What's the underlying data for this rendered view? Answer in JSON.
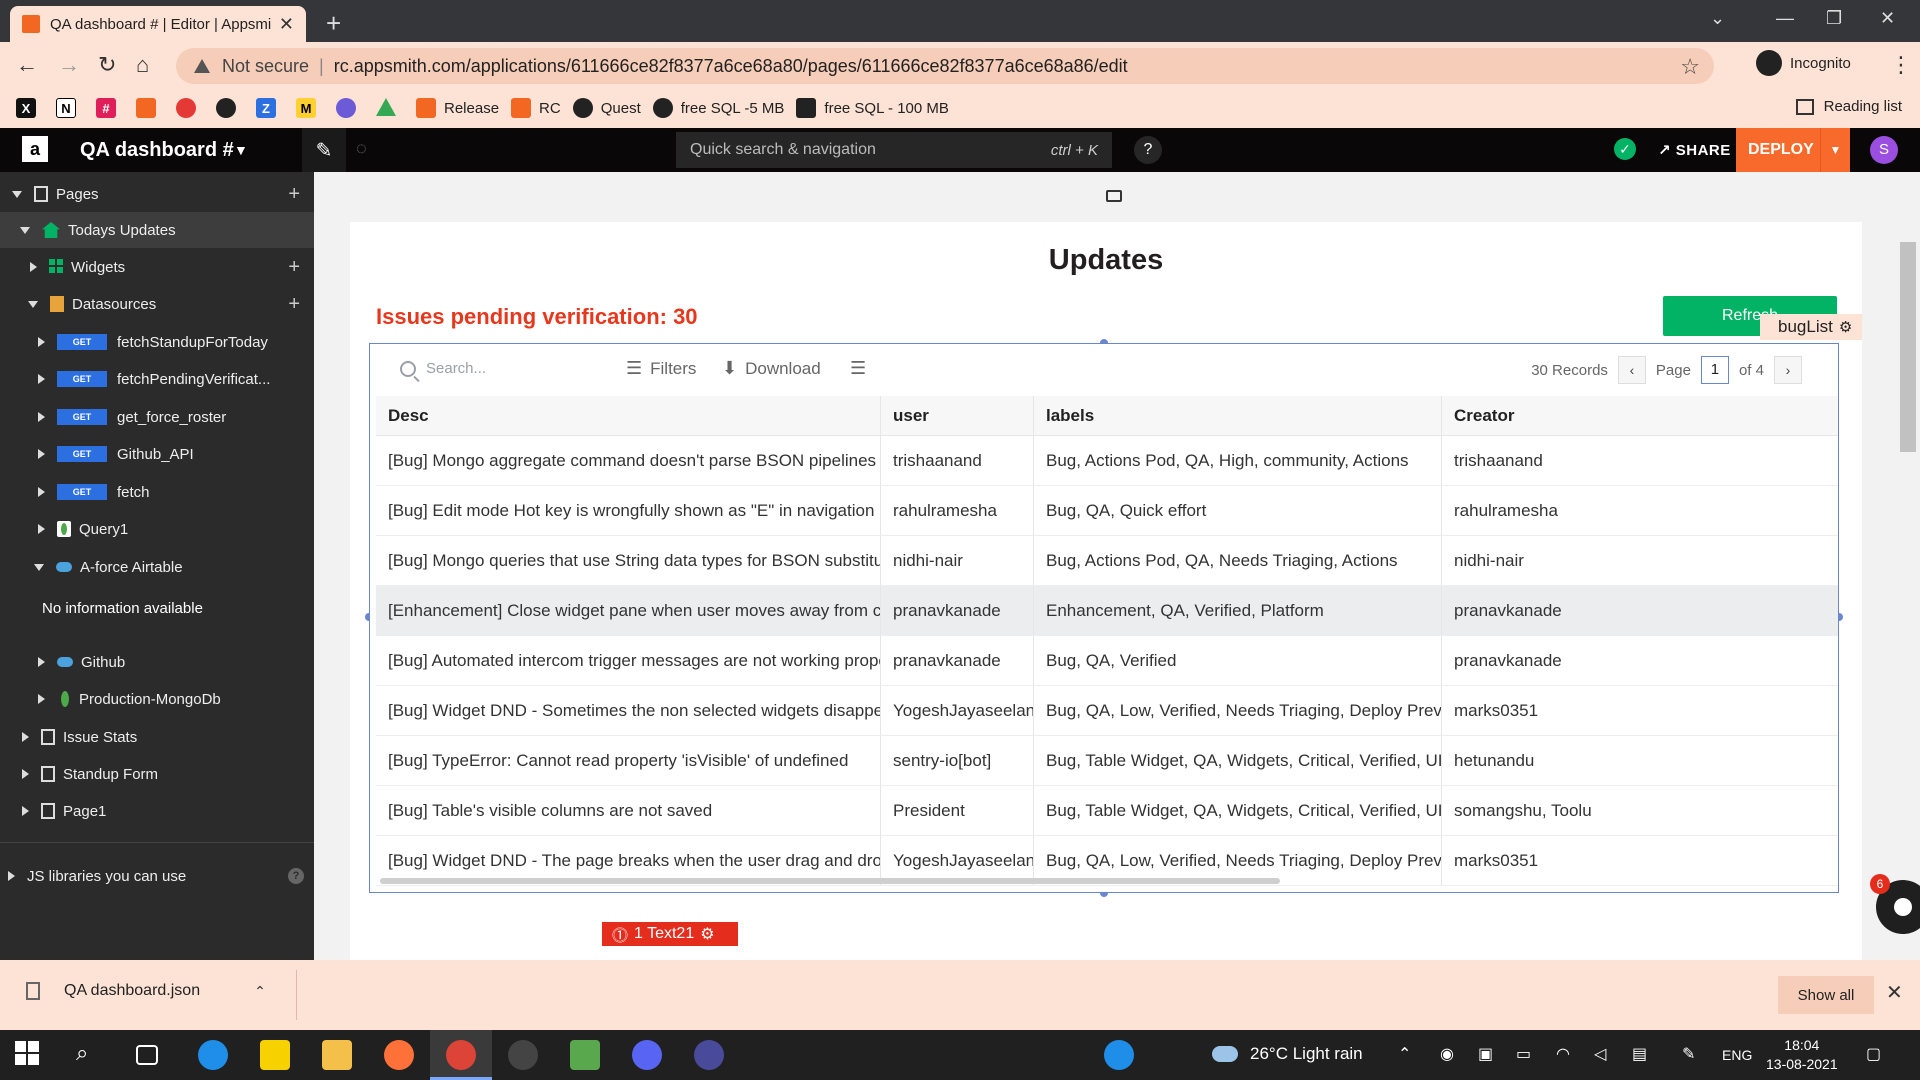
{
  "browser": {
    "tab_title": "QA dashboard # | Editor | Appsmith",
    "security_label": "Not secure",
    "url": "rc.appsmith.com/applications/611666ce82f8377a6ce68a80/pages/611666ce82f8377a6ce68a86/edit",
    "profile_label": "Incognito",
    "bookmarks": [
      "Release",
      "RC",
      "Quest",
      "free SQL -5 MB",
      "free SQL - 100 MB"
    ],
    "reading_list": "Reading list"
  },
  "app_header": {
    "logo": "a",
    "app_name": "QA dashboard #",
    "search_placeholder": "Quick search & navigation",
    "search_shortcut": "ctrl + K",
    "help": "?",
    "share": "SHARE",
    "deploy": "DEPLOY",
    "avatar": "S"
  },
  "sidebar": {
    "pages": "Pages",
    "todays_updates": "Todays Updates",
    "widgets": "Widgets",
    "datasources": "Datasources",
    "queries": [
      "fetchStandupForToday",
      "fetchPendingVerificat...",
      "get_force_roster",
      "Github_API",
      "fetch"
    ],
    "get_badge": "GET",
    "query1": "Query1",
    "airtable": "A-force Airtable",
    "no_info": "No information available",
    "github": "Github",
    "mongo": "Production-MongoDb",
    "issue_stats": "Issue Stats",
    "standup_form": "Standup Form",
    "page1": "Page1",
    "js_libs": "JS libraries you can use"
  },
  "canvas": {
    "title": "Updates",
    "pending": "Issues pending verification: 30",
    "refresh": "Refresh",
    "buglist_tag": "bugList",
    "text21_tag": "1   Text21",
    "bug_badge": "6"
  },
  "table": {
    "search_placeholder": "Search...",
    "filters": "Filters",
    "download": "Download",
    "records": "30 Records",
    "page_label": "Page",
    "page_current": "1",
    "page_total": "of 4",
    "columns": [
      "Desc",
      "user",
      "labels",
      "Creator"
    ],
    "rows": [
      [
        "[Bug] Mongo aggregate command doesn't parse BSON pipelines properly",
        "trishaanand",
        "Bug, Actions Pod, QA, High, community, Actions",
        "trishaanand"
      ],
      [
        "[Bug] Edit mode Hot key is wrongfully shown as \"E\" in navigation bar dropdown",
        "rahulramesha",
        "Bug, QA, Quick effort",
        "rahulramesha"
      ],
      [
        "[Bug] Mongo queries that use String data types for BSON substitution do not e",
        "nidhi-nair",
        "Bug, Actions Pod, QA, Needs Triaging, Actions",
        "nidhi-nair"
      ],
      [
        "[Enhancement] Close widget pane when user moves away from canvas",
        "pranavkanade",
        "Enhancement, QA, Verified, Platform",
        "pranavkanade"
      ],
      [
        "[Bug] Automated intercom trigger messages are not working properly.",
        "pranavkanade",
        "Bug, QA, Verified",
        "pranavkanade"
      ],
      [
        "[Bug] Widget DND - Sometimes the non selected widgets disappears when few",
        "YogeshJayaseelan",
        "Bug, QA, Low, Verified, Needs Triaging, Deploy Preview",
        "marks0351"
      ],
      [
        "[Bug] TypeError: Cannot read property 'isVisible' of undefined",
        "sentry-io[bot]",
        "Bug, Table Widget, QA, Widgets, Critical, Verified, UI Building Pod",
        "hetunandu"
      ],
      [
        "[Bug] Table's visible columns are not saved",
        "President",
        "Bug, Table Widget, QA, Widgets, Critical, Verified, UI Building Pod",
        "somangshu, Toolu"
      ],
      [
        "[Bug] Widget DND - The page breaks when the user drag and drops multiple g",
        "YogeshJayaseelan",
        "Bug, QA, Low, Verified, Needs Triaging, Deploy Preview",
        "marks0351"
      ]
    ],
    "highlighted_row": 3
  },
  "downloads": {
    "file": "QA dashboard.json",
    "show_all": "Show all"
  },
  "taskbar": {
    "weather": "26°C  Light rain",
    "lang": "ENG",
    "time": "18:04",
    "date": "13-08-2021"
  }
}
